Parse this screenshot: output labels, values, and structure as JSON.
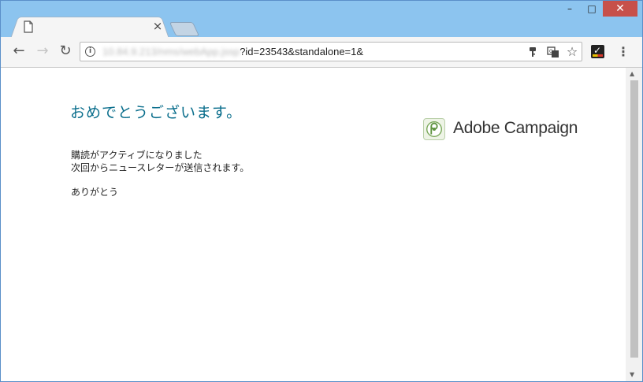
{
  "browser": {
    "tab": {
      "title": "",
      "close_glyph": "×"
    },
    "window_controls": {
      "minimize": "–",
      "maximize": "□",
      "close": "✕"
    },
    "toolbar": {
      "back_glyph": "←",
      "forward_glyph": "→",
      "reload_glyph": "↻",
      "url_host_blurred": "10.84.9.213",
      "url_path_blurred": "/nms/webApp.jssp",
      "url_query": "?id=23543&standalone=1&",
      "key_icon": "key-icon",
      "translate_icon": "translate-icon",
      "bookmark_glyph": "☆",
      "menu_glyph": "⋮"
    }
  },
  "page": {
    "heading": "おめでとうございます。",
    "logo_text": "Adobe Campaign",
    "message_line1": "購読がアクティブになりました",
    "message_line2": "次回からニュースレターが送信されます。",
    "thanks": "ありがとう"
  },
  "colors": {
    "heading": "#0a6e8c",
    "frame": "#8cc4ef",
    "close_button": "#c7504a"
  }
}
